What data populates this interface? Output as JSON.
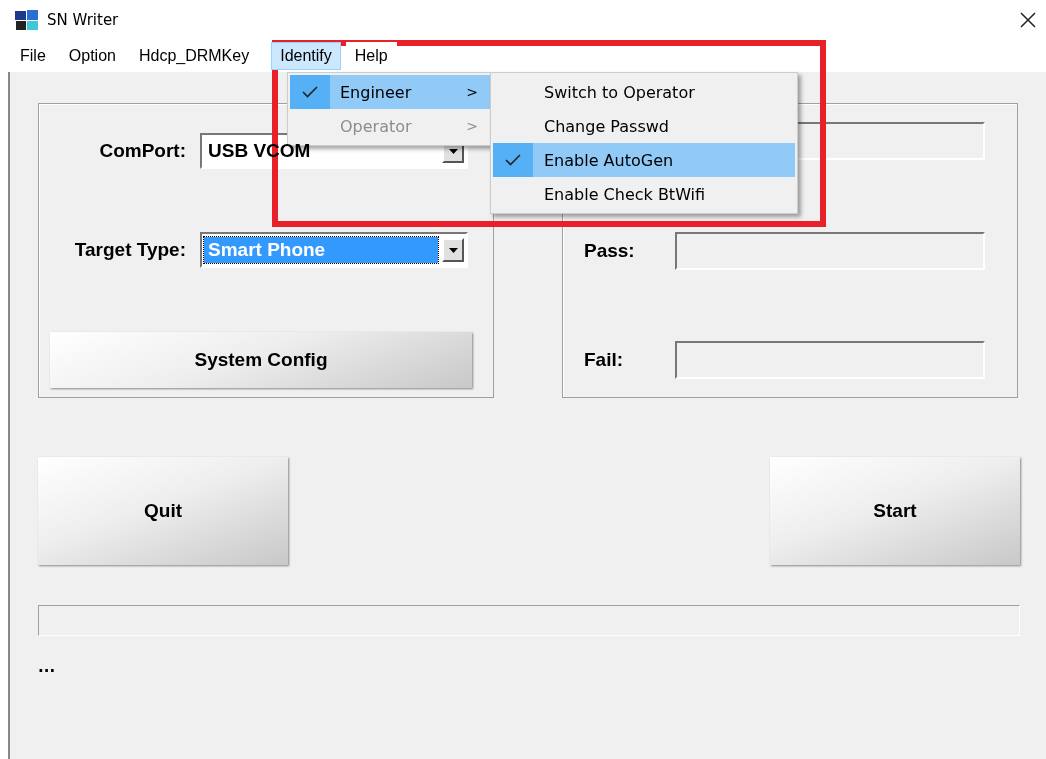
{
  "window": {
    "title": "SN Writer"
  },
  "menu_bar": [
    {
      "label": "File",
      "selected": false
    },
    {
      "label": "Option",
      "selected": false
    },
    {
      "label": "Hdcp_DRMKey",
      "selected": false
    },
    {
      "label": "Identify",
      "selected": true
    },
    {
      "label": "Help",
      "selected": false
    }
  ],
  "dropdown": [
    {
      "label": "Engineer",
      "checked": true,
      "selected": true,
      "disabled": false,
      "arrow": ">"
    },
    {
      "label": "Operator",
      "checked": false,
      "selected": false,
      "disabled": true,
      "arrow": ">"
    }
  ],
  "submenu": [
    {
      "label": "Switch to Operator",
      "checked": false,
      "selected": false
    },
    {
      "label": "Change Passwd",
      "checked": false,
      "selected": false
    },
    {
      "label": "Enable AutoGen",
      "checked": true,
      "selected": true
    },
    {
      "label": "Enable Check BtWifi",
      "checked": false,
      "selected": false
    }
  ],
  "left_panel": {
    "fields": [
      {
        "label": "ComPort:",
        "value": "USB VCOM",
        "highlighted": false
      },
      {
        "label": "Target Type:",
        "value": "Smart Phone",
        "highlighted": true
      }
    ],
    "button": "System Config"
  },
  "right_panel": {
    "fields": [
      {
        "kind": "unlabeled"
      },
      {
        "kind": "labeled",
        "label": "Pass:"
      },
      {
        "kind": "labeled",
        "label": "Fail:"
      }
    ]
  },
  "buttons": [
    "Quit",
    "Start"
  ],
  "progress": {
    "level": 0
  },
  "status": "..."
}
